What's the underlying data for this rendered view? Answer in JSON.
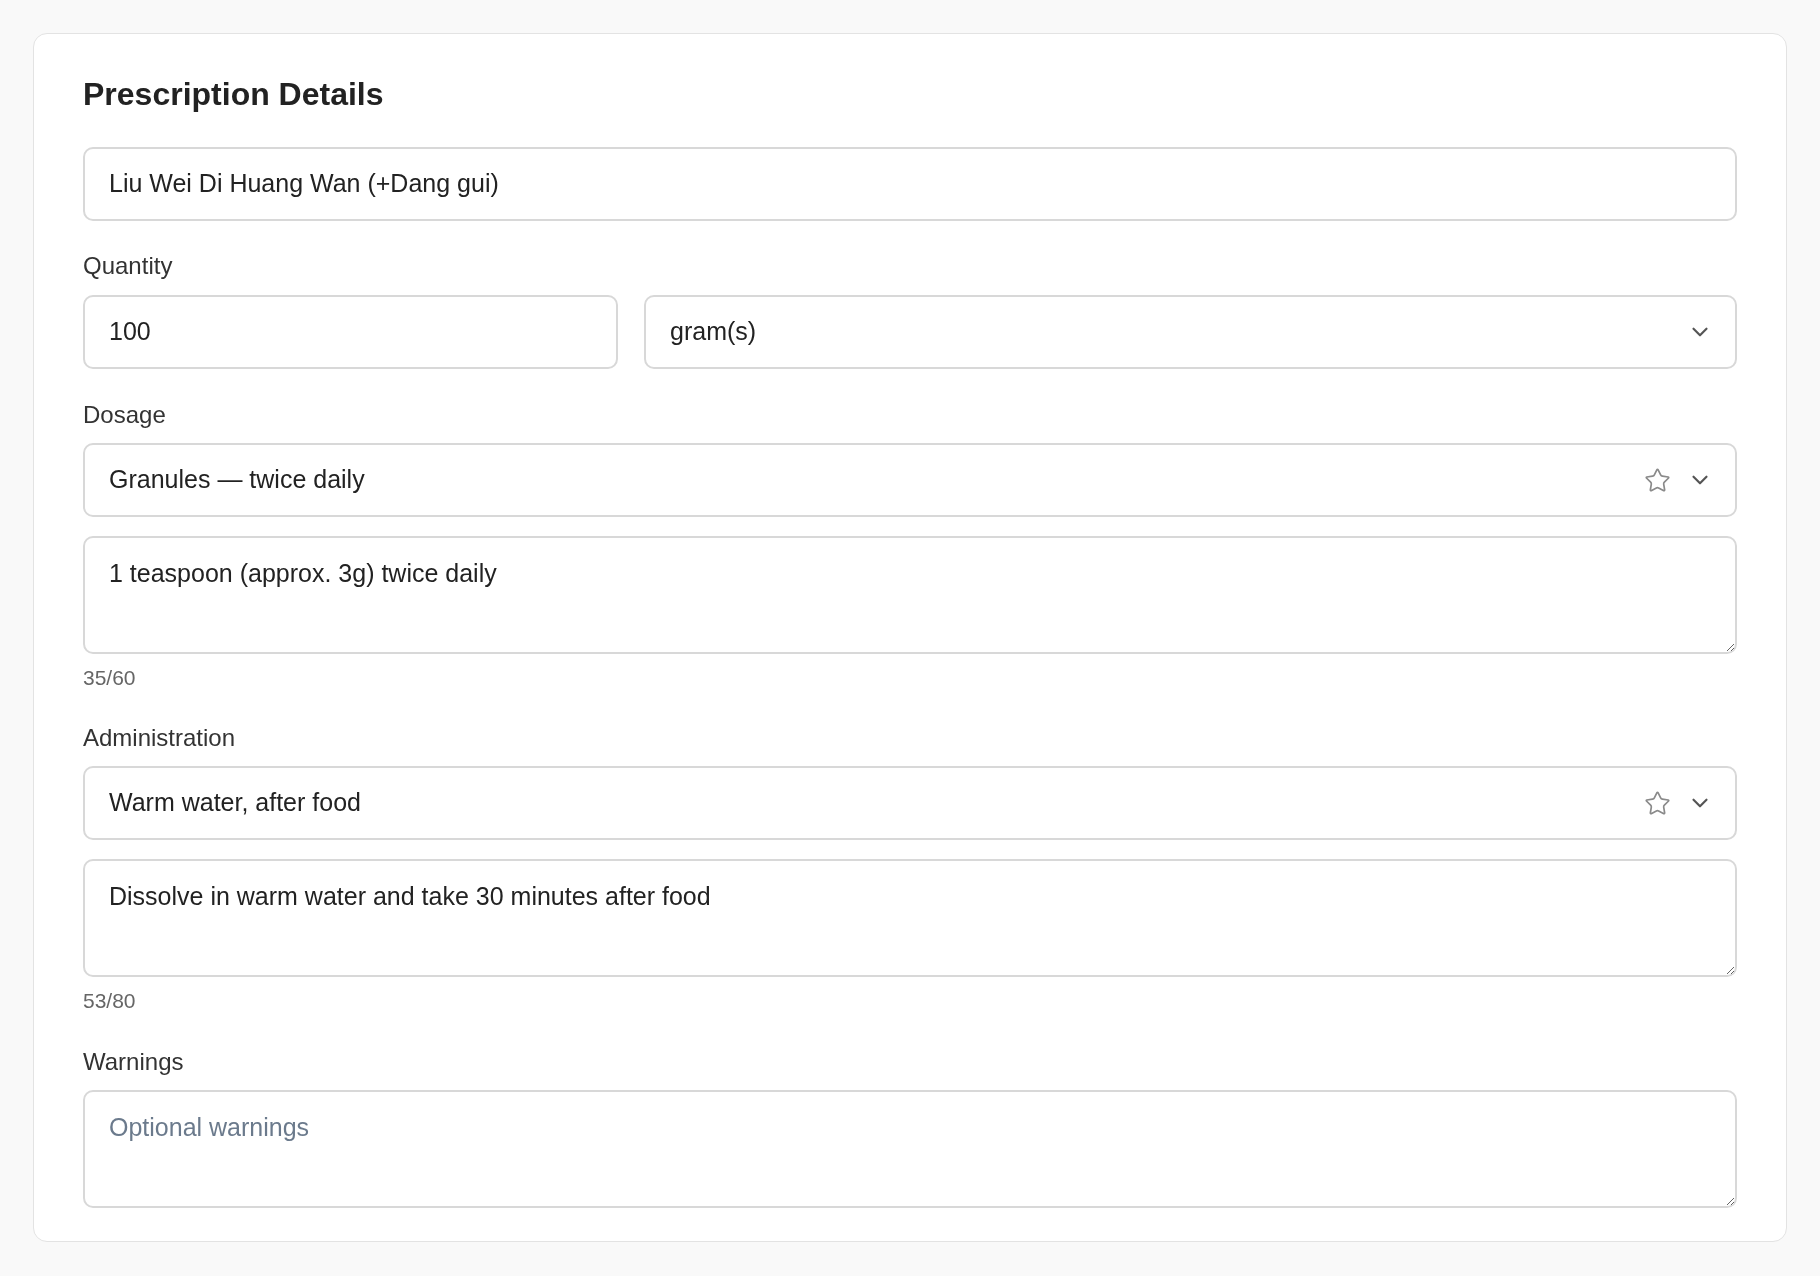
{
  "title": "Prescription Details",
  "name_field": {
    "value": "Liu Wei Di Huang Wan (+Dang gui)"
  },
  "quantity": {
    "label": "Quantity",
    "amount": "100",
    "unit": "gram(s)"
  },
  "dosage": {
    "label": "Dosage",
    "preset": "Granules — twice daily",
    "starred": false,
    "text": "1 teaspoon (approx. 3g) twice daily",
    "counter": "35/60"
  },
  "administration": {
    "label": "Administration",
    "preset": "Warm water, after food",
    "starred": false,
    "text": "Dissolve in warm water and take 30 minutes after food",
    "counter": "53/80"
  },
  "warnings": {
    "label": "Warnings",
    "placeholder": "Optional warnings"
  }
}
